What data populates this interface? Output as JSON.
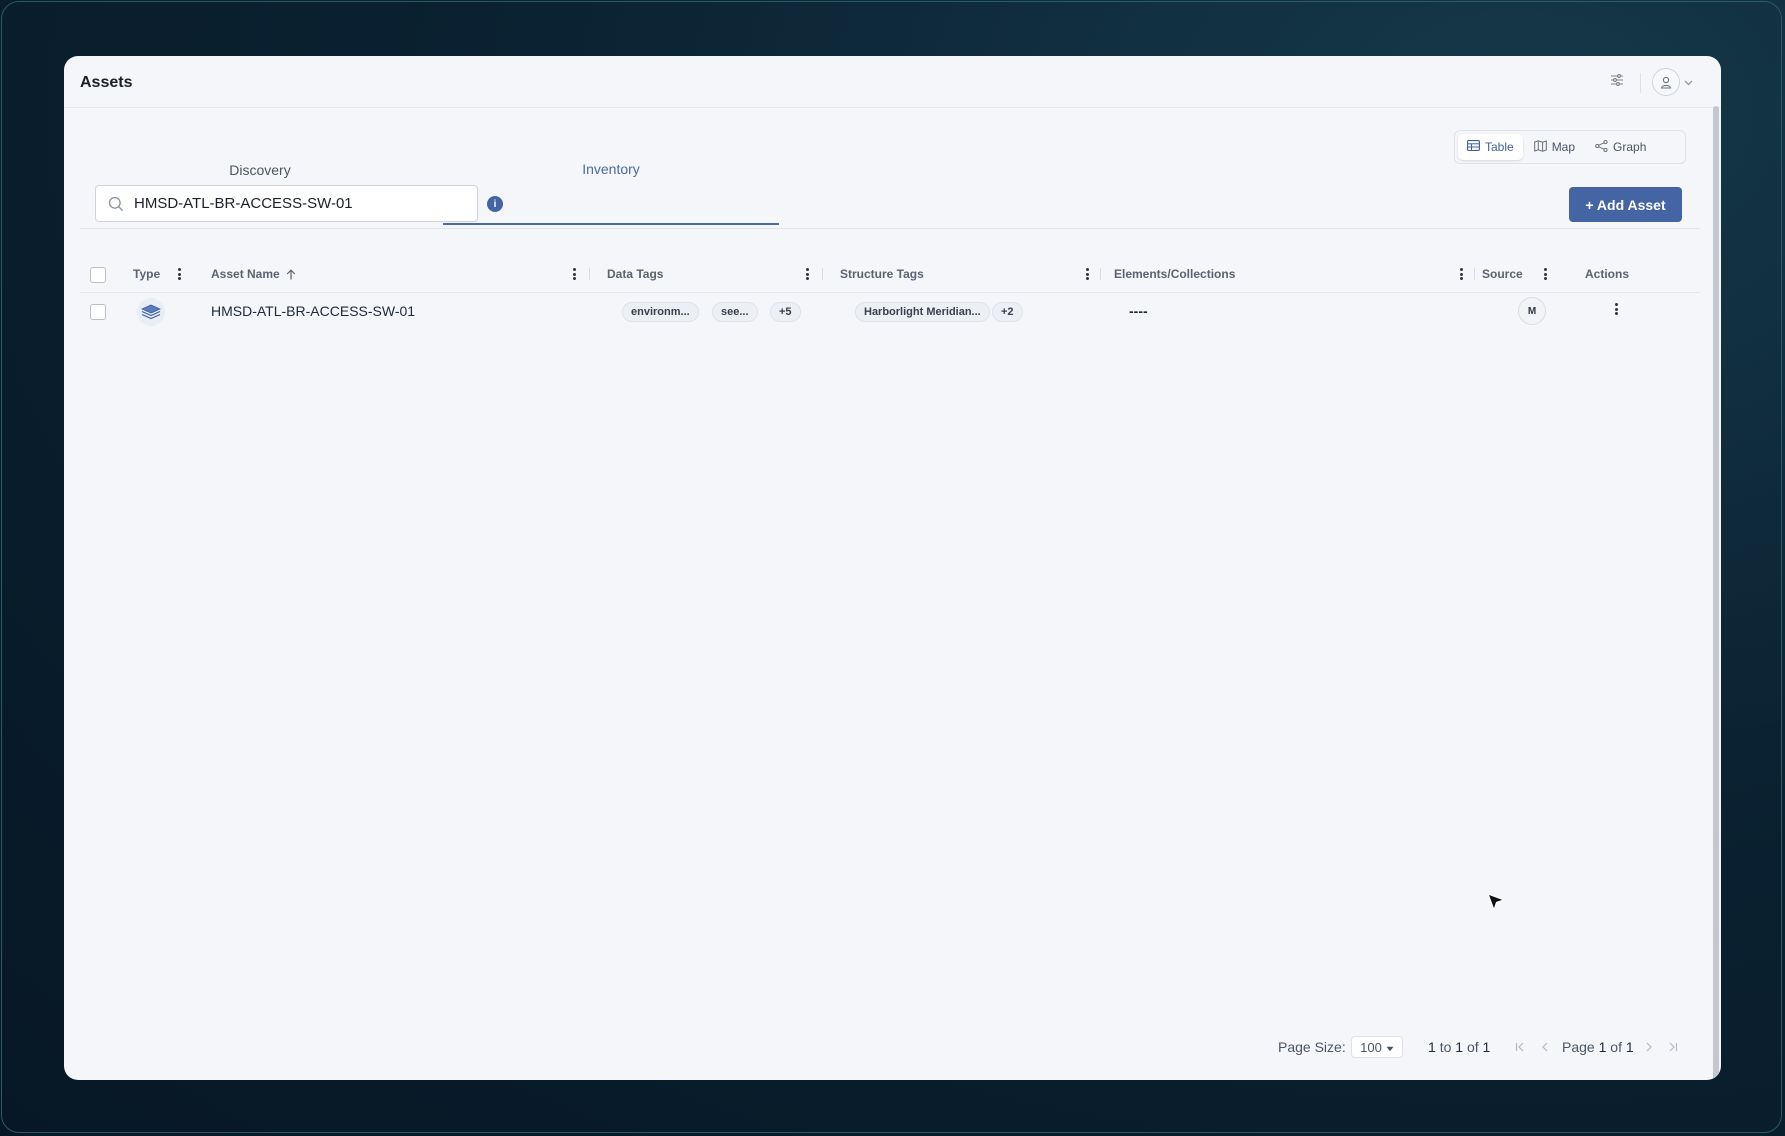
{
  "app": {
    "title": "Assets"
  },
  "tabs": [
    {
      "label": "Discovery"
    },
    {
      "label": "Inventory"
    }
  ],
  "view_toggle": {
    "table": "Table",
    "map": "Map",
    "graph": "Graph"
  },
  "search": {
    "value": "HMSD-ATL-BR-ACCESS-SW-01",
    "placeholder": ""
  },
  "add_button": {
    "label": "+ Add Asset"
  },
  "table": {
    "headers": {
      "type": "Type",
      "asset_name": "Asset Name",
      "data_tags": "Data Tags",
      "structure_tags": "Structure Tags",
      "elements": "Elements/Collections",
      "source": "Source",
      "actions": "Actions"
    },
    "rows": [
      {
        "type_icon": "switch-stack-icon",
        "asset_name": "HMSD-ATL-BR-ACCESS-SW-01",
        "data_tags": [
          "environm...",
          "see..."
        ],
        "data_tags_more": "+5",
        "structure_tags": [
          "Harborlight Meridian..."
        ],
        "structure_tags_more": "+2",
        "elements": "----",
        "source": "M"
      }
    ]
  },
  "footer": {
    "page_size_label": "Page Size:",
    "page_size_value": "100",
    "range_from": "1",
    "range_to_label": "to",
    "range_to": "1",
    "range_of_label": "of",
    "range_total": "1",
    "page_label": "Page",
    "page_current": "1",
    "page_of_label": "of",
    "page_total": "1"
  },
  "colors": {
    "accent": "#4564a3",
    "tab_active": "#4a6aa8",
    "window_bg": "#f4f6fa"
  }
}
